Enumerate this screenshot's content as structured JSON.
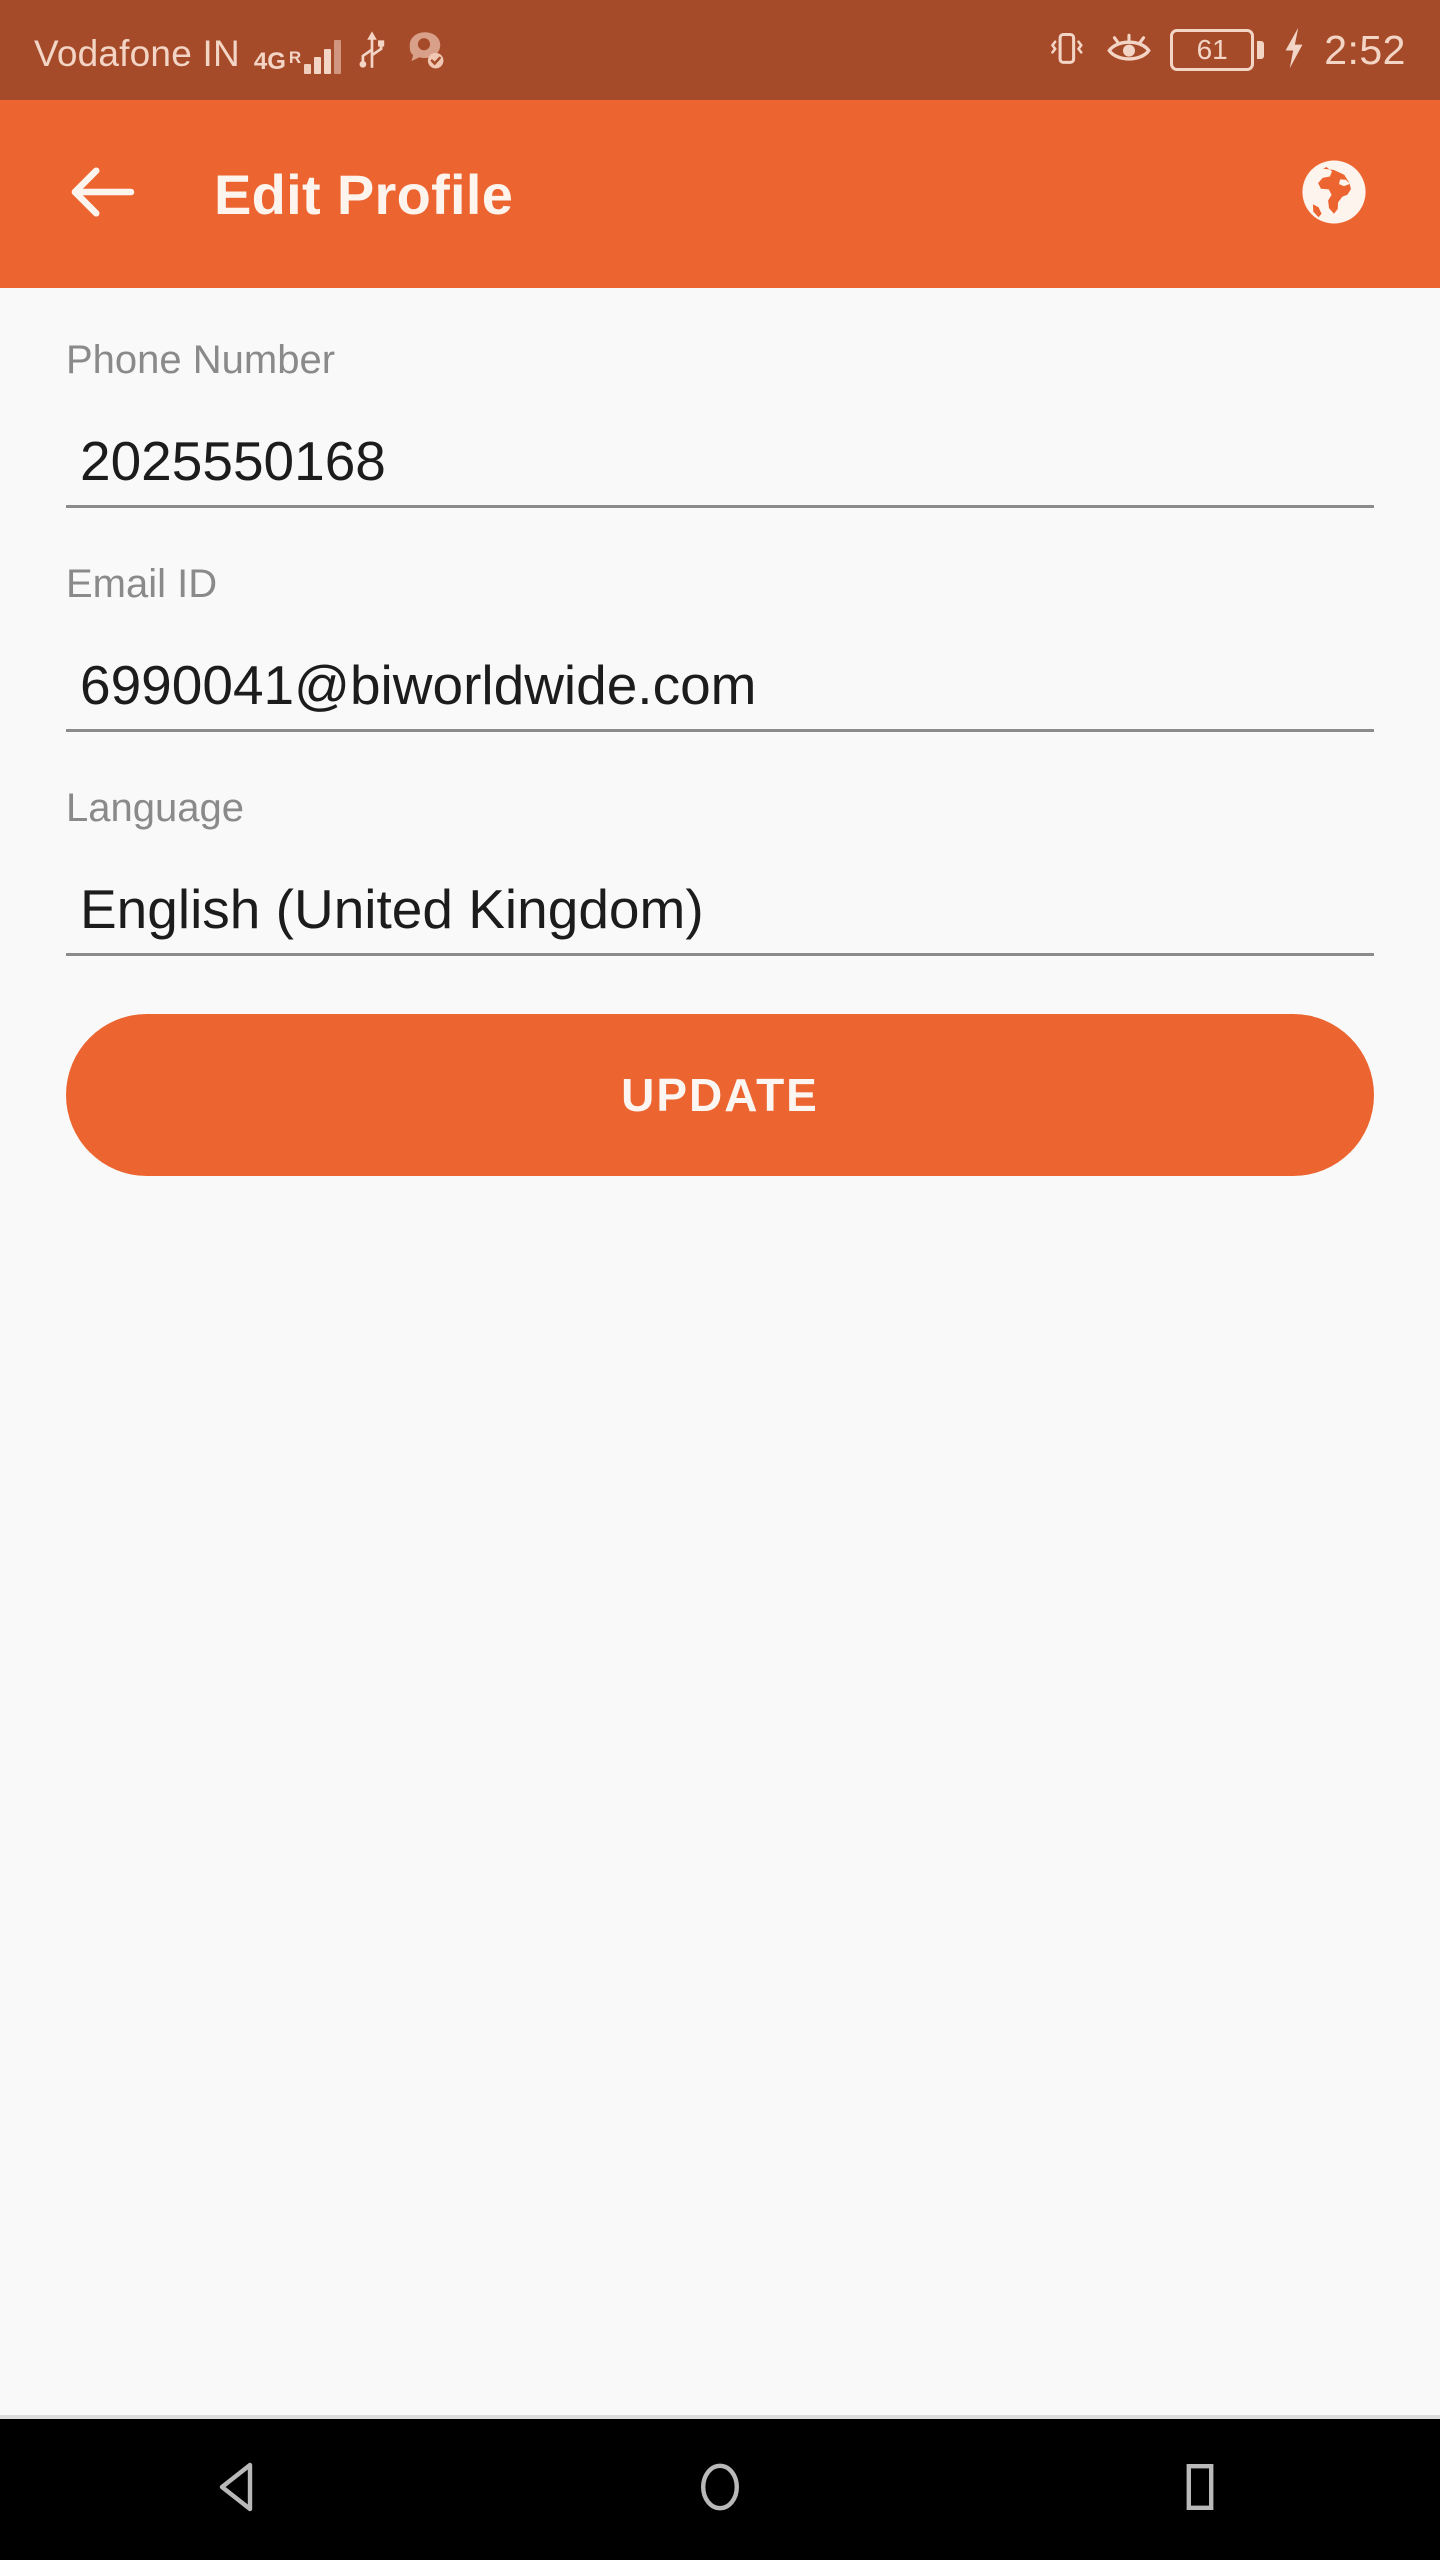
{
  "status_bar": {
    "carrier": "Vodafone IN",
    "network_type": "4G",
    "roaming_indicator": "R",
    "icons": [
      "signal-bars-icon",
      "usb-icon",
      "headset-message-icon",
      "vibrate-icon",
      "eye-comfort-icon"
    ],
    "battery_level": "61",
    "charging": true,
    "time": "2:52",
    "background_color": "#A64B2A",
    "foreground_color": "#F3D5C6"
  },
  "app_bar": {
    "title": "Edit Profile",
    "back_icon": "arrow-left-icon",
    "action_icon": "globe-icon",
    "background_color": "#EC6530",
    "text_color": "#FDF4EE"
  },
  "form": {
    "fields": [
      {
        "label": "Phone Number",
        "value": "2025550168",
        "placeholder": "Phone Number",
        "type": "tel"
      },
      {
        "label": "Email ID",
        "value": "6990041@biworldwide.com",
        "placeholder": "Email ID",
        "type": "email"
      },
      {
        "label": "Language",
        "value": "English (United Kingdom)",
        "placeholder": "Language",
        "type": "text"
      }
    ],
    "submit_label": "UPDATE",
    "submit_color": "#EC6530",
    "label_color": "#8A8A8A",
    "value_color": "#1C1C1C",
    "background_color": "#F9F9F9"
  },
  "nav_bar": {
    "items": [
      {
        "name": "back",
        "icon": "triangle-back-icon"
      },
      {
        "name": "home",
        "icon": "circle-home-icon"
      },
      {
        "name": "recents",
        "icon": "square-recents-icon"
      }
    ],
    "background_color": "#000000"
  }
}
